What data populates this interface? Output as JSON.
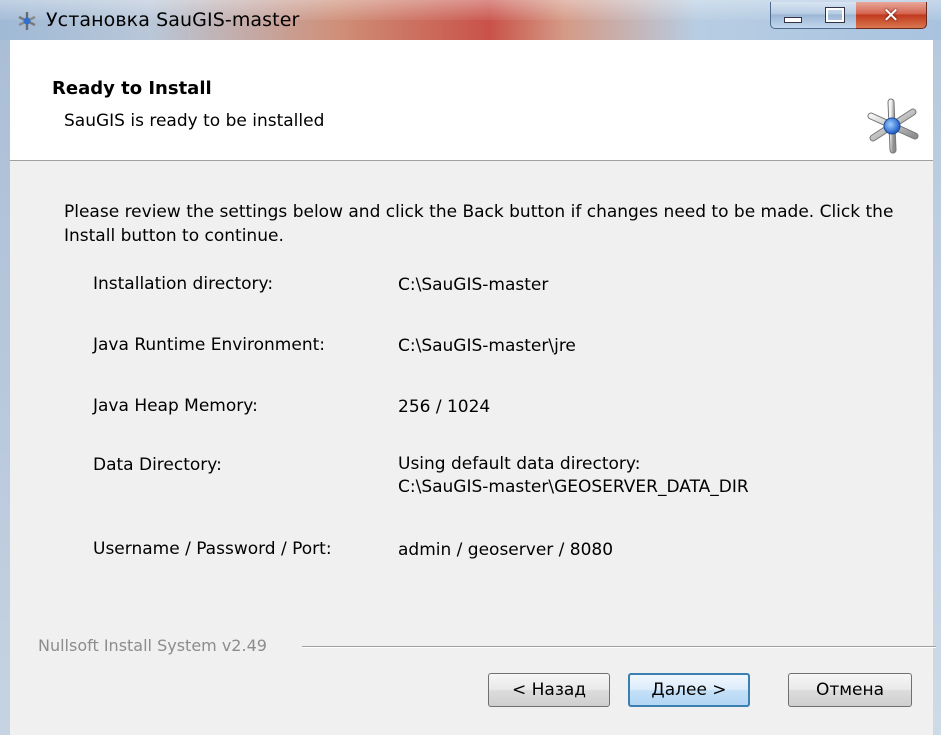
{
  "window": {
    "title": "Установка SauGIS-master",
    "icon": "nsis-installer-icon"
  },
  "header": {
    "title": "Ready to Install",
    "subtitle": "SauGIS is ready to be installed",
    "icon": "saugis-star-icon"
  },
  "body": {
    "intro": "Please review the settings below and click the Back button if changes need to be made.  Click the Install button to continue.",
    "settings": [
      {
        "label": "Installation directory:",
        "value": "C:\\SauGIS-master"
      },
      {
        "label": "Java Runtime Environment:",
        "value": "C:\\SauGIS-master\\jre"
      },
      {
        "label": "Java Heap Memory:",
        "value": "256 / 1024"
      },
      {
        "label": "Data Directory:",
        "value": "Using default data directory:",
        "value2": "C:\\SauGIS-master\\GEOSERVER_DATA_DIR"
      },
      {
        "label": "Username / Password / Port:",
        "value": "admin / geoserver / 8080"
      }
    ]
  },
  "footer": {
    "branding": "Nullsoft Install System v2.49",
    "back_label": "< Назад",
    "next_label": "Далее >",
    "cancel_label": "Отмена"
  },
  "colors": {
    "focus_border": "#3c7fb1",
    "dialog_background": "#f0f0f0",
    "close_button": "#c0391e"
  }
}
